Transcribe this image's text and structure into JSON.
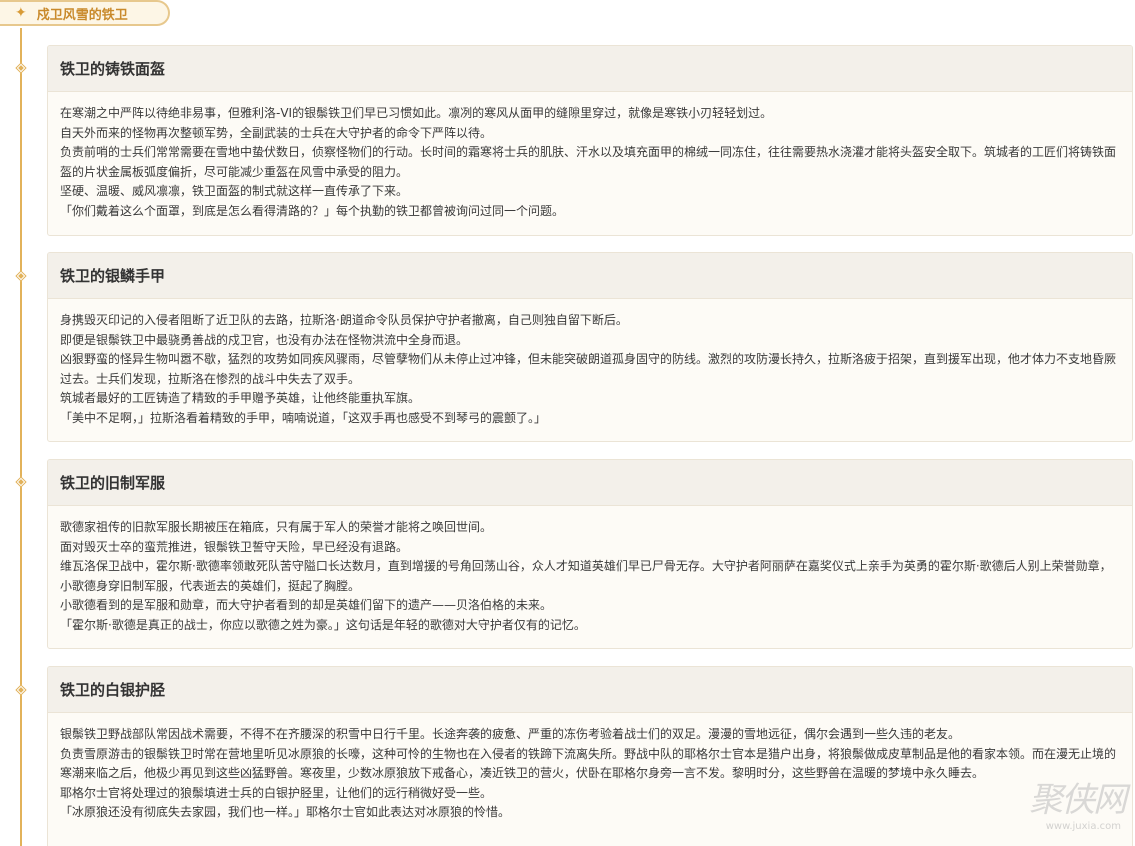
{
  "section": {
    "title": "戍卫风雪的铁卫",
    "star_icon": "sparkle-icon"
  },
  "colors": {
    "accent": "#e2b25a",
    "tag_text": "#c98a2c",
    "card_bg": "#fdfbf6",
    "card_head_bg": "#f3f0ea"
  },
  "cards": [
    {
      "title": "铁卫的铸铁面盔",
      "paragraphs": [
        "在寒潮之中严阵以待绝非易事，但雅利洛-VI的银鬃铁卫们早已习惯如此。凛冽的寒风从面甲的缝隙里穿过，就像是寒铁小刃轻轻划过。",
        "自天外而来的怪物再次整顿军势，全副武装的士兵在大守护者的命令下严阵以待。",
        "负责前哨的士兵们常常需要在雪地中蛰伏数日，侦察怪物们的行动。长时间的霜寒将士兵的肌肤、汗水以及填充面甲的棉绒一同冻住，往往需要热水浇灌才能将头盔安全取下。筑城者的工匠们将铸铁面盔的片状金属板弧度偏折，尽可能减少重盔在风雪中承受的阻力。",
        "坚硬、温暖、威风凛凛，铁卫面盔的制式就这样一直传承了下来。",
        "「你们戴着这么个面罩，到底是怎么看得清路的？」每个执勤的铁卫都曾被询问过同一个问题。"
      ]
    },
    {
      "title": "铁卫的银鳞手甲",
      "paragraphs": [
        "身携毁灭印记的入侵者阻断了近卫队的去路，拉斯洛·朗道命令队员保护守护者撤离，自己则独自留下断后。",
        "即便是银鬃铁卫中最骁勇善战的戍卫官，也没有办法在怪物洪流中全身而退。",
        "凶狠野蛮的怪异生物叫嚣不歇，猛烈的攻势如同疾风骤雨，尽管孽物们从未停止过冲锋，但未能突破朗道孤身固守的防线。激烈的攻防漫长持久，拉斯洛疲于招架，直到援军出现，他才体力不支地昏厥过去。士兵们发现，拉斯洛在惨烈的战斗中失去了双手。",
        "筑城者最好的工匠铸造了精致的手甲赠予英雄，让他终能重执军旗。",
        "「美中不足啊，」拉斯洛看着精致的手甲，喃喃说道，「这双手再也感受不到琴弓的震颤了。」"
      ]
    },
    {
      "title": "铁卫的旧制军服",
      "paragraphs": [
        "歌德家祖传的旧款军服长期被压在箱底，只有属于军人的荣誉才能将之唤回世间。",
        "面对毁灭士卒的蛮荒推进，银鬃铁卫誓守天险，早已经没有退路。",
        "维瓦洛保卫战中，霍尔斯·歌德率领敢死队苦守隘口长达数月，直到增援的号角回荡山谷，众人才知道英雄们早已尸骨无存。大守护者阿丽萨在嘉奖仪式上亲手为英勇的霍尔斯·歌德后人别上荣誉勋章，小歌德身穿旧制军服，代表逝去的英雄们，挺起了胸膛。",
        "小歌德看到的是军服和勋章，而大守护者看到的却是英雄们留下的遗产——贝洛伯格的未来。",
        "「霍尔斯·歌德是真正的战士，你应以歌德之姓为豪。」这句话是年轻的歌德对大守护者仅有的记忆。"
      ]
    },
    {
      "title": "铁卫的白银护胫",
      "paragraphs": [
        "银鬃铁卫野战部队常因战术需要，不得不在齐腰深的积雪中日行千里。长途奔袭的疲惫、严重的冻伤考验着战士们的双足。漫漫的雪地远征，偶尔会遇到一些久违的老友。",
        "负责雪原游击的银鬃铁卫时常在营地里听见冰原狼的长嚎，这种可怜的生物也在入侵者的铁蹄下流离失所。野战中队的耶格尔士官本是猎户出身，将狼鬃做成皮草制品是他的看家本领。而在漫无止境的寒潮来临之后，他极少再见到这些凶猛野兽。寒夜里，少数冰原狼放下戒备心，凑近铁卫的营火，伏卧在耶格尔身旁一言不发。黎明时分，这些野兽在温暖的梦境中永久睡去。",
        "耶格尔士官将处理过的狼鬃填进士兵的白银护胫里，让他们的远行稍微好受一些。",
        "「冰原狼还没有彻底失去家园，我们也一样。」耶格尔士官如此表达对冰原狼的怜惜。"
      ]
    }
  ],
  "watermark": {
    "text": "聚侠网",
    "url": "www.juxia.com"
  }
}
